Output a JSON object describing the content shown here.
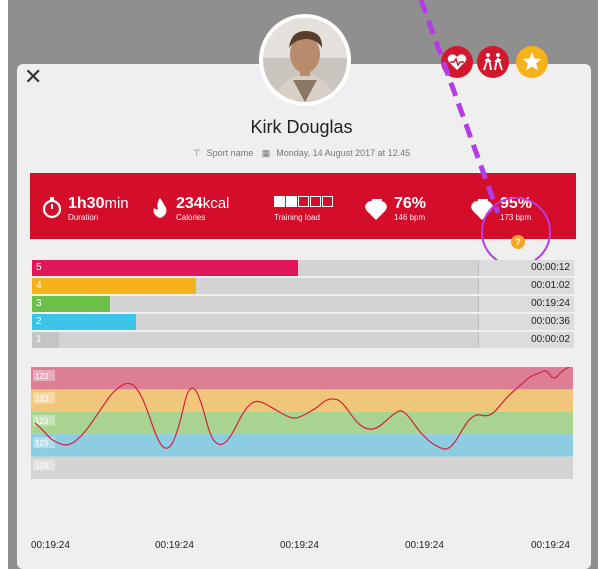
{
  "user": {
    "name": "Kirk Douglas"
  },
  "meta": {
    "sport": "Sport name",
    "date": "Monday, 14 August 2017 at 12.45"
  },
  "badges": [
    {
      "icon": "heart-pulse-icon",
      "color": "#d1182f"
    },
    {
      "icon": "runners-icon",
      "color": "#d1182f"
    },
    {
      "icon": "star-icon",
      "color": "#f6b21a"
    }
  ],
  "stats": {
    "duration": {
      "h": "1h",
      "m": "30",
      "unit": "min",
      "label": "Duration"
    },
    "calories": {
      "value": "234",
      "unit": "kcal",
      "label": "Calories"
    },
    "training_load": {
      "label": "Training load",
      "filled": 2,
      "total": 5
    },
    "avg": {
      "tag": "AVG",
      "value": "76%",
      "bpm": "146 bpm"
    },
    "max": {
      "tag": "MAX",
      "value": "95%",
      "bpm": "173 bpm",
      "hint": "?"
    }
  },
  "zones": [
    {
      "num": "5",
      "color": "#e0185a",
      "fraction": 0.58,
      "time": "00:00:12"
    },
    {
      "num": "4",
      "color": "#f6b21a",
      "fraction": 0.34,
      "time": "00:01:02"
    },
    {
      "num": "3",
      "color": "#6cc04a",
      "fraction": 0.14,
      "time": "00:19:24"
    },
    {
      "num": "2",
      "color": "#3cc3e8",
      "fraction": 0.2,
      "time": "00:00:36"
    },
    {
      "num": "1",
      "color": "#c4c4c4",
      "fraction": 0.02,
      "time": "00:00:02"
    }
  ],
  "chart_data": {
    "type": "line",
    "bands": [
      {
        "label": "123",
        "color": "#dc7e94"
      },
      {
        "label": "123",
        "color": "#f0c77a"
      },
      {
        "label": "123",
        "color": "#a8d391"
      },
      {
        "label": "123",
        "color": "#8dcde2"
      },
      {
        "label": "123",
        "color": "#d3d3d3"
      }
    ],
    "x_ticks": [
      "00:19:24",
      "00:19:24",
      "00:19:24",
      "00:19:24",
      "00:19:24"
    ],
    "series": [
      {
        "color": "#d1213b",
        "values": [
          2.5,
          2.2,
          1.8,
          1.6,
          1.5,
          1.6,
          1.9,
          2.3,
          2.8,
          3.3,
          3.8,
          4.1,
          4.3,
          4.2,
          3.7,
          2.8,
          1.8,
          1.3,
          1.5,
          2.5,
          4.0,
          4.1,
          3.2,
          1.9,
          1.5,
          1.6,
          2.1,
          2.8,
          3.3,
          3.5,
          3.4,
          3.2,
          3.0,
          2.8,
          2.7,
          2.8,
          3.0,
          3.2,
          3.5,
          3.6,
          3.5,
          3.1,
          2.6,
          2.3,
          2.2,
          2.3,
          2.6,
          2.9,
          3.1,
          2.8,
          2.3,
          1.9,
          1.6,
          1.4,
          1.3,
          1.6,
          2.2,
          2.7,
          2.9,
          2.8,
          2.9,
          3.3,
          3.7,
          4.0,
          4.3,
          4.6,
          4.7,
          4.9,
          4.4,
          4.8,
          5.0
        ]
      }
    ],
    "ylim": [
      0,
      5
    ]
  }
}
